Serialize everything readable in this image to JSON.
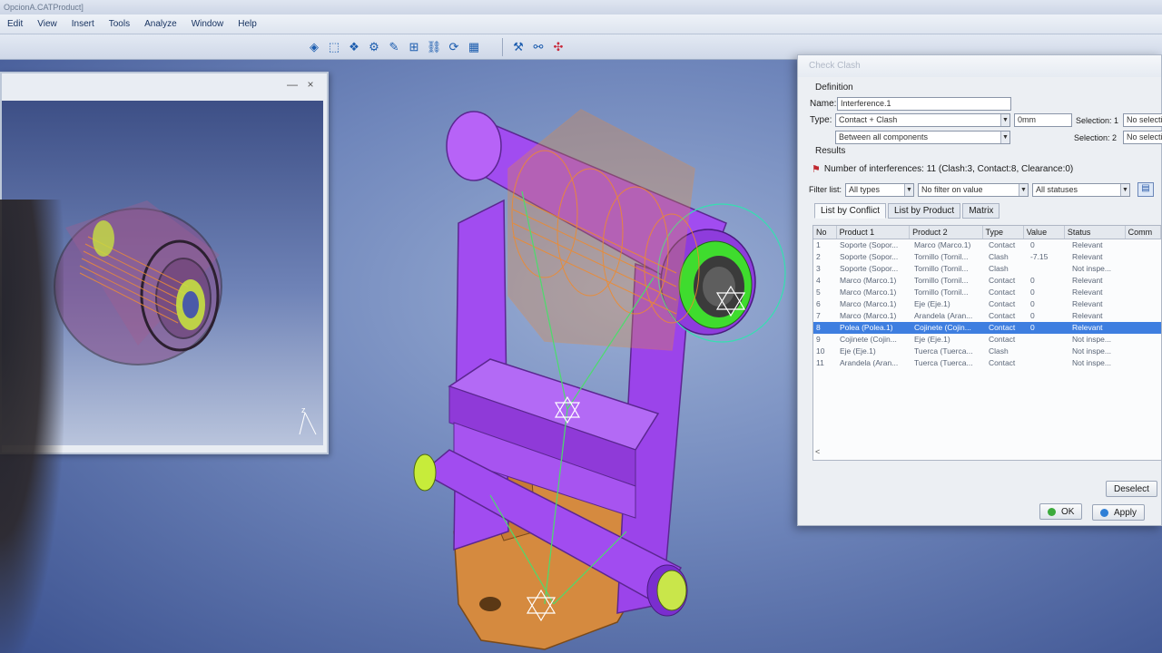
{
  "app": {
    "title": "OpcionA.CATProduct]"
  },
  "menu": [
    "Edit",
    "View",
    "Insert",
    "Tools",
    "Analyze",
    "Window",
    "Help"
  ],
  "toolbar": {
    "icons": [
      "shape-icon",
      "cube-icon",
      "assembly-icon",
      "gear-icon",
      "pencil-icon",
      "measure-icon",
      "constraint-icon",
      "refresh-icon",
      "mesh-icon",
      "clash-icon",
      "section-icon",
      "compass-icon"
    ]
  },
  "preview": {
    "minimize": "—",
    "close": "×",
    "axis": "z"
  },
  "dialog": {
    "title": "Check Clash",
    "definition_label": "Definition",
    "name_label": "Name:",
    "name_value": "Interference.1",
    "type_label": "Type:",
    "type_value": "Contact + Clash",
    "clearance_value": "0mm",
    "scope_value": "Between all components",
    "selection1_label": "Selection: 1",
    "selection1_value": "No selecti",
    "selection2_label": "Selection: 2",
    "selection2_value": "No selecti",
    "results_label": "Results",
    "summary": "Number of interferences: 11 (Clash:3, Contact:8, Clearance:0)",
    "filter_label": "Filter list:",
    "filter_type": "All types",
    "filter_value": "No filter on value",
    "filter_status": "All statuses",
    "tabs": [
      "List by Conflict",
      "List by Product",
      "Matrix"
    ],
    "columns": [
      "No",
      "Product 1",
      "Product 2",
      "Type",
      "Value",
      "Status",
      "Comm"
    ],
    "rows": [
      [
        "1",
        "Soporte (Sopor...",
        "Marco (Marco.1)",
        "Contact",
        "0",
        "Relevant"
      ],
      [
        "2",
        "Soporte (Sopor...",
        "Tornillo (Tornil...",
        "Clash",
        "-7.15",
        "Relevant"
      ],
      [
        "3",
        "Soporte (Sopor...",
        "Tornillo (Tornil...",
        "Clash",
        "",
        "Not inspe..."
      ],
      [
        "4",
        "Marco (Marco.1)",
        "Tornillo (Tornil...",
        "Contact",
        "0",
        "Relevant"
      ],
      [
        "5",
        "Marco (Marco.1)",
        "Tornillo (Tornil...",
        "Contact",
        "0",
        "Relevant"
      ],
      [
        "6",
        "Marco (Marco.1)",
        "Eje (Eje.1)",
        "Contact",
        "0",
        "Relevant"
      ],
      [
        "7",
        "Marco (Marco.1)",
        "Arandela (Aran...",
        "Contact",
        "0",
        "Relevant"
      ],
      [
        "8",
        "Polea (Polea.1)",
        "Cojinete (Cojin...",
        "Contact",
        "0",
        "Relevant"
      ],
      [
        "9",
        "Cojinete (Cojin...",
        "Eje (Eje.1)",
        "Contact",
        "",
        "Not inspe..."
      ],
      [
        "10",
        "Eje (Eje.1)",
        "Tuerca (Tuerca...",
        "Clash",
        "",
        "Not inspe..."
      ],
      [
        "11",
        "Arandela (Aran...",
        "Tuerca (Tuerca...",
        "Contact",
        "",
        "Not inspe..."
      ]
    ],
    "selected_row": 8,
    "scroll_left": "<",
    "deselect_label": "Deselect",
    "ok_label": "OK",
    "apply_label": "Apply"
  },
  "colors": {
    "frame": "#a243f0",
    "support": "#d98a3c",
    "pulley": "#cf8a4a",
    "bolt_end": "#6fdc3a",
    "selection": "#3e7ee0"
  }
}
